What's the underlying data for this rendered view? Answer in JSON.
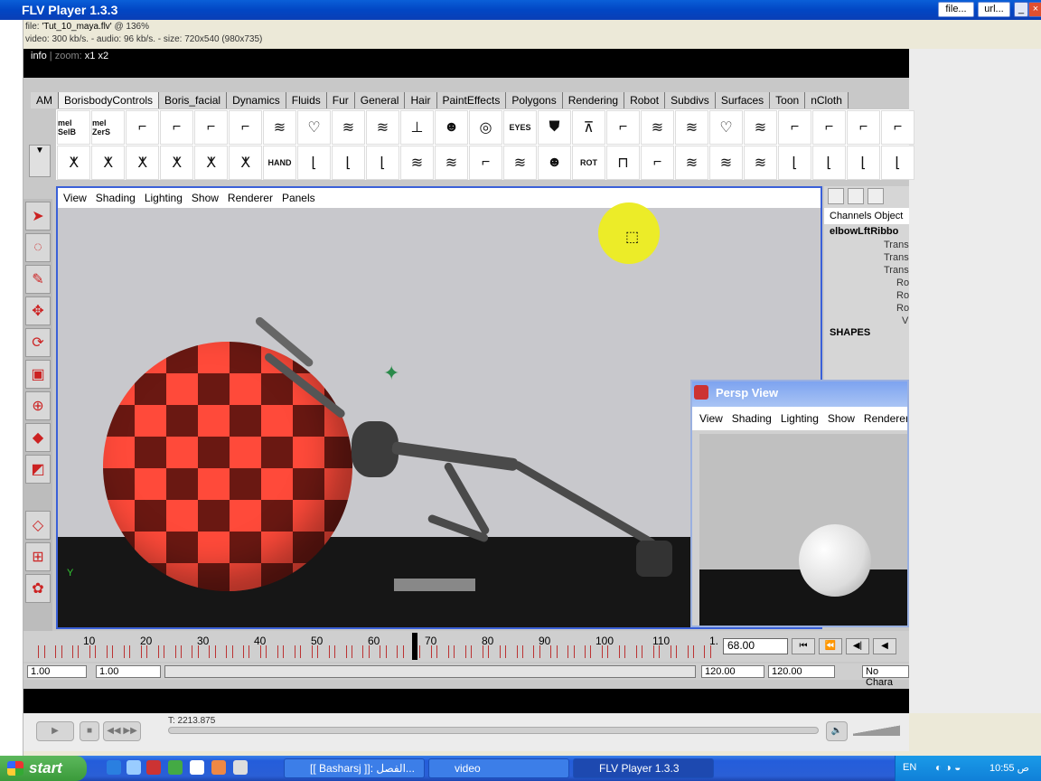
{
  "window": {
    "title": "FLV Player 1.3.3",
    "file_button": "file...",
    "url_button": "url...",
    "minimize": "_",
    "close": "×"
  },
  "fileinfo": {
    "line1_prefix": "file: ",
    "filename": "'Tut_10_maya.flv'",
    "zoom_pct": " @ 136%",
    "line2": "video: 300 kb/s. - audio: 96 kb/s. - size: 720x540 (980x735)"
  },
  "infobar": {
    "info": "info",
    "zoom_label": " | zoom:",
    "x1": "x1",
    "x2": "x2"
  },
  "maya": {
    "shelf_tabs": [
      "AM",
      "BorisbodyControls",
      "Boris_facial",
      "Dynamics",
      "Fluids",
      "Fur",
      "General",
      "Hair",
      "PaintEffects",
      "Polygons",
      "Rendering",
      "Robot",
      "Subdivs",
      "Surfaces",
      "Toon",
      "nCloth"
    ],
    "shelf_labels": {
      "a": "mel SelB",
      "b": "mel ZerS",
      "hand": "HAND",
      "eyes": "EYES",
      "rot": "ROT"
    },
    "viewport_menu": [
      "View",
      "Shading",
      "Lighting",
      "Show",
      "Renderer",
      "Panels"
    ],
    "channels": {
      "tab1": "Channels",
      "tab2": "Object",
      "node": "elbowLftRibbo",
      "rows": [
        "Trans",
        "Trans",
        "Trans",
        "Ro",
        "Ro",
        "Ro",
        "V"
      ],
      "shapes": "SHAPES"
    },
    "persp": {
      "title": "Persp View",
      "menu": [
        "View",
        "Shading",
        "Lighting",
        "Show",
        "Renderer"
      ]
    },
    "timeline": {
      "ticks": [
        "10",
        "20",
        "30",
        "40",
        "50",
        "60",
        "70",
        "80",
        "90",
        "100",
        "110",
        "1."
      ],
      "current_frame": "68.00",
      "range_start": "1.00",
      "range_start2": "1.00",
      "range_end": "120.00",
      "range_end2": "120.00",
      "character": "No Chara"
    }
  },
  "player": {
    "timecode": "T: 2213.875"
  },
  "taskbar": {
    "start": "start",
    "tasks": [
      "[[ Basharsj ]]: الفصل...",
      "video",
      "FLV Player 1.3.3"
    ],
    "lang": "EN",
    "clock": "10:55 ص"
  }
}
